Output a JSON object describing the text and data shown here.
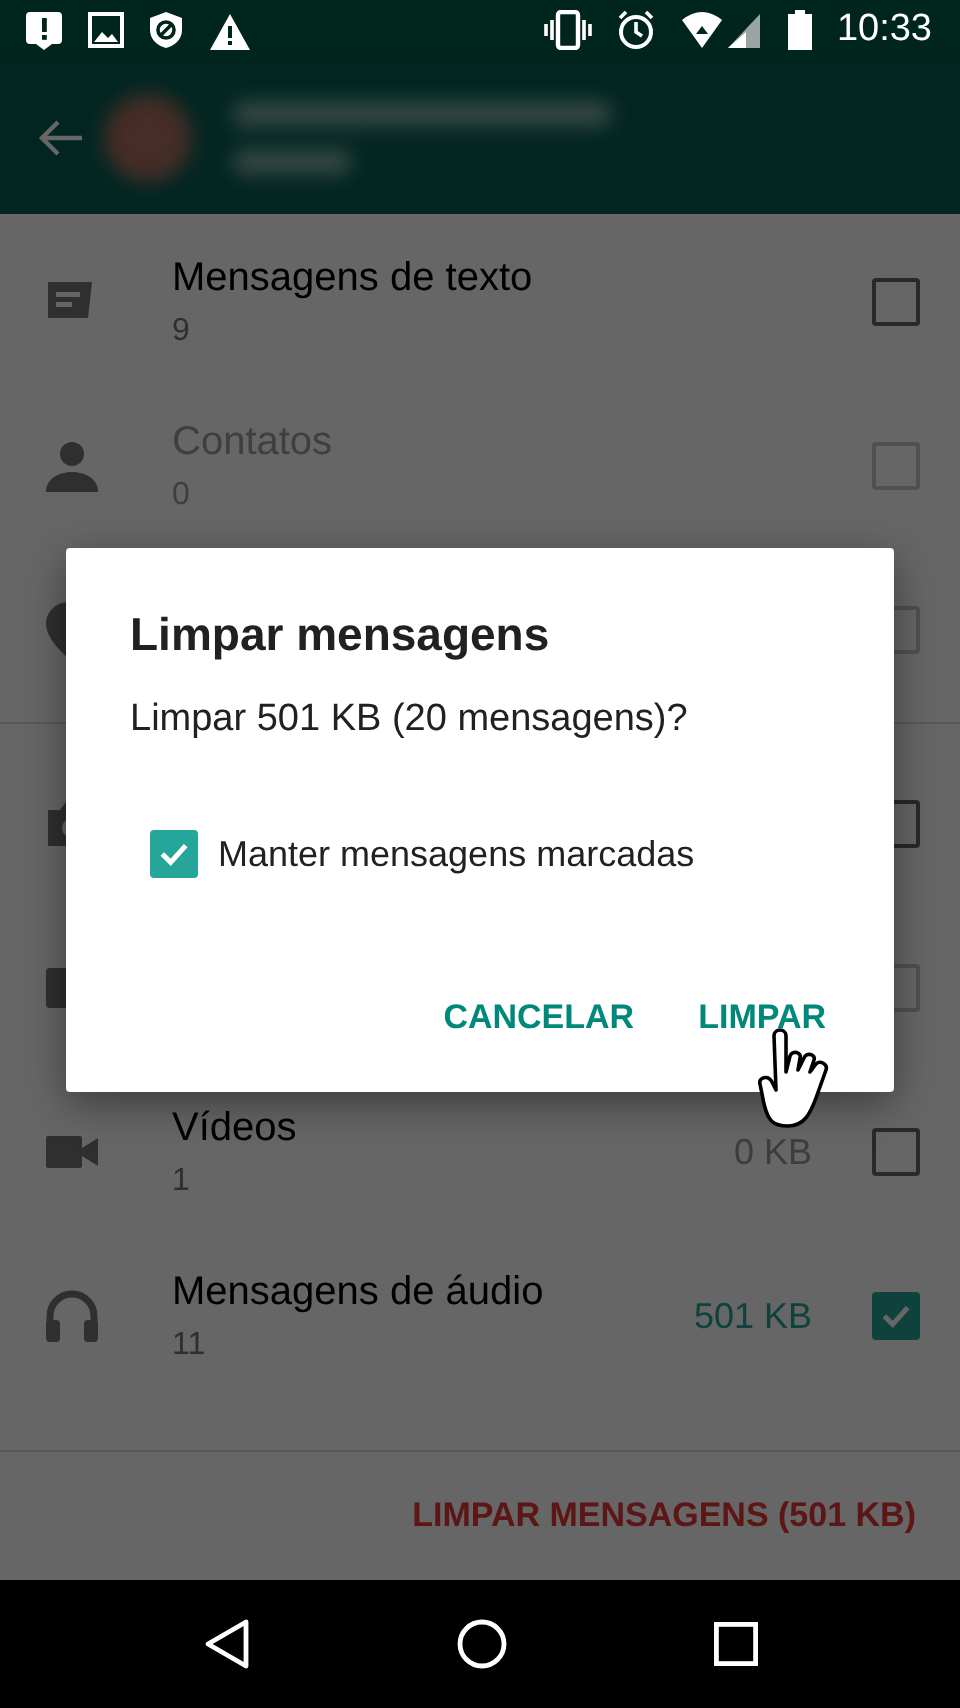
{
  "status_bar": {
    "time": "10:33"
  },
  "sections": [
    {
      "rows": [
        {
          "title": "Mensagens de texto",
          "count": "9",
          "checked": false,
          "disabled": false
        },
        {
          "title": "Contatos",
          "count": "0",
          "checked": false,
          "disabled": true
        },
        {
          "disabled": true
        }
      ]
    },
    {
      "rows": [
        {
          "disabled": false
        },
        {
          "disabled": true
        },
        {
          "title": "Vídeos",
          "count": "1",
          "size": "0 KB",
          "checked": false,
          "disabled": false
        },
        {
          "title": "Mensagens de áudio",
          "count": "11",
          "size": "501 KB",
          "checked": true,
          "disabled": false
        }
      ]
    }
  ],
  "footer_button": "LIMPAR MENSAGENS (501 KB)",
  "dialog": {
    "title": "Limpar mensagens",
    "message": "Limpar 501 KB (20 mensagens)?",
    "option": {
      "label": "Manter mensagens marcadas",
      "checked": true
    },
    "buttons": [
      "CANCELAR",
      "LIMPAR"
    ]
  }
}
